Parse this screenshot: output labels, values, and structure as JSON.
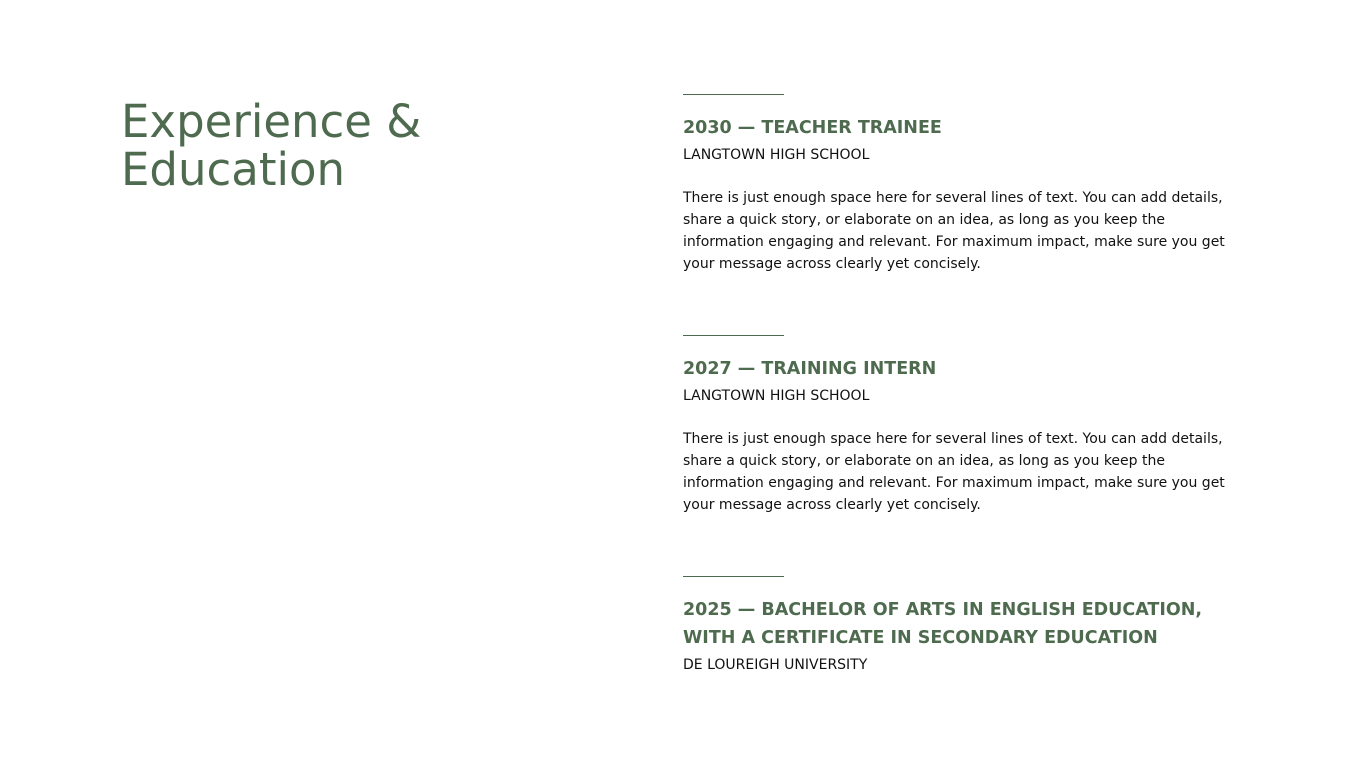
{
  "title": "Experience & Education",
  "entries": [
    {
      "heading": "2030 — TEACHER TRAINEE",
      "organization": "LANGTOWN HIGH SCHOOL",
      "description": "There is just enough space here for several lines of text. You can add details, share a quick story, or elaborate on an idea, as long as you keep the information engaging and relevant. For maximum impact, make sure you get your message across clearly yet concisely."
    },
    {
      "heading": "2027 — TRAINING INTERN",
      "organization": "LANGTOWN HIGH SCHOOL",
      "description": "There is just enough space here for several lines of text. You can add details, share a quick story, or elaborate on an idea, as long as you keep the information engaging and relevant. For maximum impact, make sure you get your message across clearly yet concisely."
    },
    {
      "heading": "2025 — BACHELOR OF ARTS IN ENGLISH EDUCATION, WITH A CERTIFICATE IN SECONDARY EDUCATION",
      "organization": "DE LOUREIGH UNIVERSITY"
    }
  ],
  "colors": {
    "accent": "#4f6b4f",
    "text": "#111111",
    "background": "#ffffff"
  }
}
